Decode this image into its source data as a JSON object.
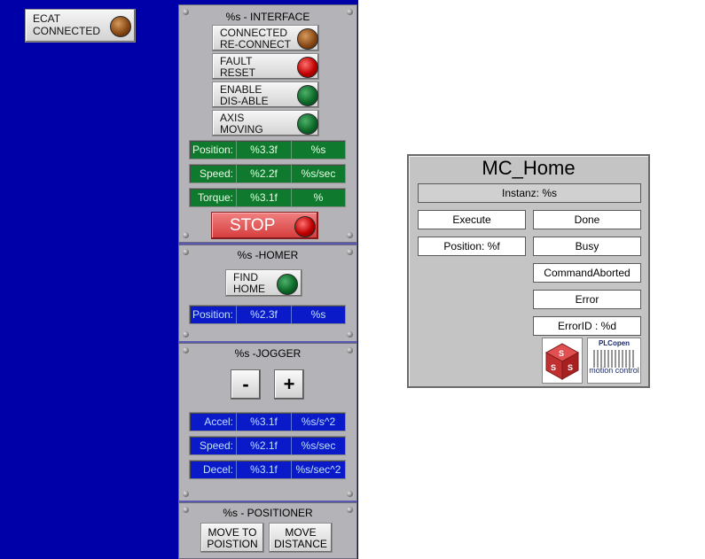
{
  "ecat": {
    "label_line1": "ECAT",
    "label_line2": "CONNECTED"
  },
  "interface": {
    "title": "%s - INTERFACE",
    "buttons": [
      {
        "line1": "CONNECTED",
        "line2": "RE-CONNECT",
        "lamp": "brown"
      },
      {
        "line1": "FAULT",
        "line2": "RESET",
        "lamp": "red"
      },
      {
        "line1": "ENABLE",
        "line2": "DIS-ABLE",
        "lamp": "green"
      },
      {
        "line1": "AXIS",
        "line2": "MOVING",
        "lamp": "green"
      }
    ],
    "readouts": [
      {
        "label": "Position:",
        "value": "%3.3f",
        "unit": "%s"
      },
      {
        "label": "Speed:",
        "value": "%2.2f",
        "unit": "%s/sec"
      },
      {
        "label": "Torque:",
        "value": "%3.1f",
        "unit": "%"
      }
    ],
    "stop_label": "STOP"
  },
  "homer": {
    "title": "%s -HOMER",
    "find_home_line1": "FIND",
    "find_home_line2": "HOME",
    "readout": {
      "label": "Position:",
      "value": "%2.3f",
      "unit": "%s"
    }
  },
  "jogger": {
    "title": "%s -JOGGER",
    "minus_label": "-",
    "plus_label": "+",
    "readouts": [
      {
        "label": "Accel:",
        "value": "%3.1f",
        "unit": "%s/s^2"
      },
      {
        "label": "Speed:",
        "value": "%2.1f",
        "unit": "%s/sec"
      },
      {
        "label": "Decel:",
        "value": "%3.1f",
        "unit": "%s/sec^2"
      }
    ]
  },
  "positioner": {
    "title": "%s - POSITIONER",
    "move_to_position_line1": "MOVE TO",
    "move_to_position_line2": "POISTION",
    "move_distance_line1": "MOVE",
    "move_distance_line2": "DISTANCE"
  },
  "fb": {
    "title": "MC_Home",
    "instance": "Instanz: %s",
    "execute": "Execute",
    "done": "Done",
    "position": "Position: %f",
    "busy": "Busy",
    "command_aborted": "CommandAborted",
    "error": "Error",
    "error_id": "ErrorID : %d",
    "plcopen_logo_text": "PLCopen",
    "motion_control_text": "motion control"
  },
  "colors": {
    "background_blue": "#0000a8",
    "panel_gray": "#b4b4b8",
    "readout_green": "#0f7a2e",
    "readout_blue": "#0a1ac8",
    "stop_red": "#d63c3c"
  }
}
